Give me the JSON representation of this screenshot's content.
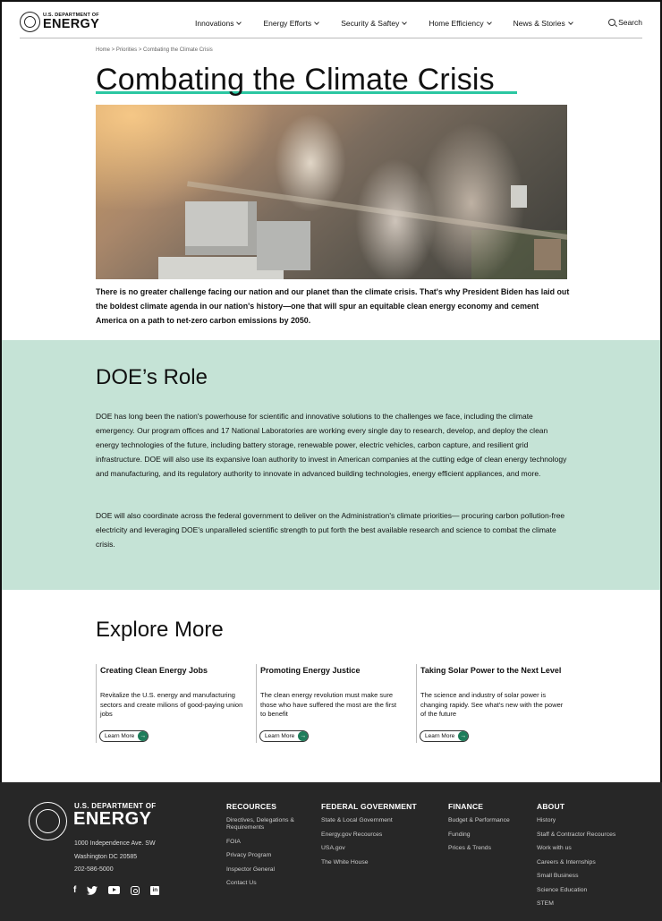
{
  "header": {
    "logo_small": "U.S. DEPARTMENT OF",
    "logo_big": "ENERGY",
    "nav": [
      "Innovations",
      "Energy Efforts",
      "Security & Saftey",
      "Home Efficiency",
      "News & Stories"
    ],
    "search_label": "Search"
  },
  "breadcrumb": "Home > Priorities > Combating the Climate Crisis",
  "page_title": "Combating the Climate Crisis",
  "intro": "There is no greater challenge facing our nation and our planet than the climate crisis. That's why President Biden has laid out the boldest climate agenda in our nation's history—one that will spur an equitable clean energy economy and cement America on a path to net-zero carbon emissions by 2050.",
  "role": {
    "title": "DOE’s Role",
    "p1": "DOE has long been the nation's powerhouse for scientific and innovative solutions to the challenges we face, including the climate emergency. Our program offices and 17 National Laboratories are working every single day to research, develop, and deploy the clean energy technologies of the future, including battery storage, renewable power, electric vehicles, carbon capture, and resilient grid infrastructure. DOE will also use its expansive loan authority to invest in American companies at the cutting edge of clean energy technology and manufacturing, and its regulatory authority to innovate in advanced building technologies, energy efficient appliances, and more.",
    "p2": "DOE will also coordinate across the federal government to deliver on the Administration's climate priorities— procuring carbon pollution-free electricity and leveraging DOE's unparalleled scientific strength to put forth the best available research and science to combat the climate crisis."
  },
  "explore": {
    "title": "Explore More",
    "cards": [
      {
        "title": "Creating Clean Energy Jobs",
        "desc": "Revitalize the U.S. energy and manufacturing sectors and create milions of good-paying union jobs",
        "button": "Learn More"
      },
      {
        "title": "Promoting Energy Justice",
        "desc": "The clean energy revolution must make sure those who have suffered the most are the first to benefit",
        "button": "Learn More"
      },
      {
        "title": "Taking Solar Power to the Next Level",
        "desc": "The science and industry of solar power is changing rapidy. See what's new with the power of the future",
        "button": "Learn More"
      }
    ]
  },
  "footer": {
    "logo_small": "U.S. DEPARTMENT OF",
    "logo_big": "ENERGY",
    "address": [
      "1000 Independence Ave. SW",
      "Washington DC 20585",
      "202-586-5000"
    ],
    "columns": [
      {
        "title": "RECOURCES",
        "links": [
          "Directives, Delegations & Requirements",
          "FOIA",
          "Privacy Program",
          "Inspector General",
          "Contact Us"
        ]
      },
      {
        "title": "FEDERAL GOVERNMENT",
        "links": [
          "State & Local Government",
          "Energy.gov Recources",
          "USA.gov",
          "The White House"
        ]
      },
      {
        "title": "FINANCE",
        "links": [
          "Budget & Performance",
          "Funding",
          "Prices & Trends"
        ]
      },
      {
        "title": "ABOUT",
        "links": [
          "History",
          "Staff & Contractor Recources",
          "Work with us",
          "Careers & Internships",
          "Small Business",
          "Science Education",
          "STEM"
        ]
      }
    ],
    "social": [
      "facebook-icon",
      "twitter-icon",
      "youtube-icon",
      "instagram-icon",
      "linkedin-icon"
    ]
  },
  "colors": {
    "accent": "#2bc7a2",
    "role_bg": "#c5e3d6",
    "footer_bg": "#272727",
    "button_green": "#1e7c5a"
  }
}
